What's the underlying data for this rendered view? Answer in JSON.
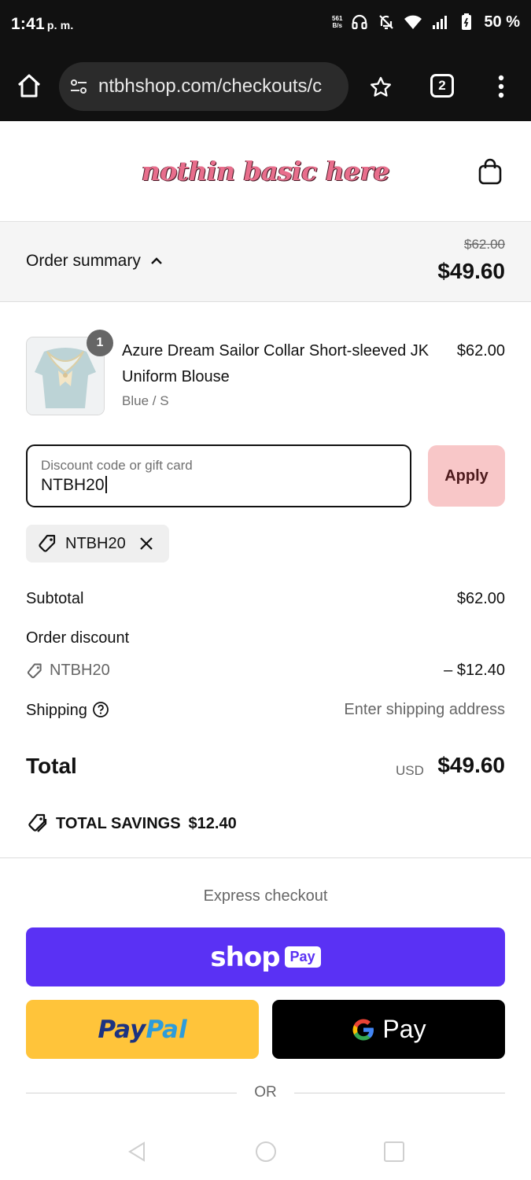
{
  "status_bar": {
    "time": "1:41",
    "time_suffix": "p. m.",
    "net_speed_value": "561",
    "net_speed_unit": "B/s",
    "battery": "50 %"
  },
  "browser": {
    "url": "ntbhshop.com/checkouts/c",
    "tab_count": "2"
  },
  "shop": {
    "logo_text": "nothin basic here"
  },
  "order_summary": {
    "label": "Order summary",
    "original_price": "$62.00",
    "current_price": "$49.60"
  },
  "product": {
    "name": "Azure Dream Sailor Collar Short-sleeved JK Uniform Blouse",
    "variant": "Blue / S",
    "price": "$62.00",
    "quantity": "1"
  },
  "discount": {
    "label": "Discount code or gift card",
    "value": "NTBH20",
    "apply_label": "Apply",
    "applied_code": "NTBH20"
  },
  "totals": {
    "subtotal_label": "Subtotal",
    "subtotal_value": "$62.00",
    "order_discount_label": "Order discount",
    "discount_code": "NTBH20",
    "discount_value": "– $12.40",
    "shipping_label": "Shipping",
    "shipping_value": "Enter shipping address",
    "total_label": "Total",
    "currency": "USD",
    "total_value": "$49.60",
    "savings_label": "TOTAL SAVINGS",
    "savings_value": "$12.40"
  },
  "express": {
    "label": "Express checkout",
    "shop_word": "shop",
    "shop_badge": "Pay",
    "paypal_part1": "Pay",
    "paypal_part2": "Pal",
    "gpay_word": "Pay",
    "or_label": "OR"
  },
  "colors": {
    "shop_pay": "#5a31f4",
    "paypal": "#ffc43a",
    "apply_button": "#f8c7c8",
    "logo": "#e86e8c"
  }
}
